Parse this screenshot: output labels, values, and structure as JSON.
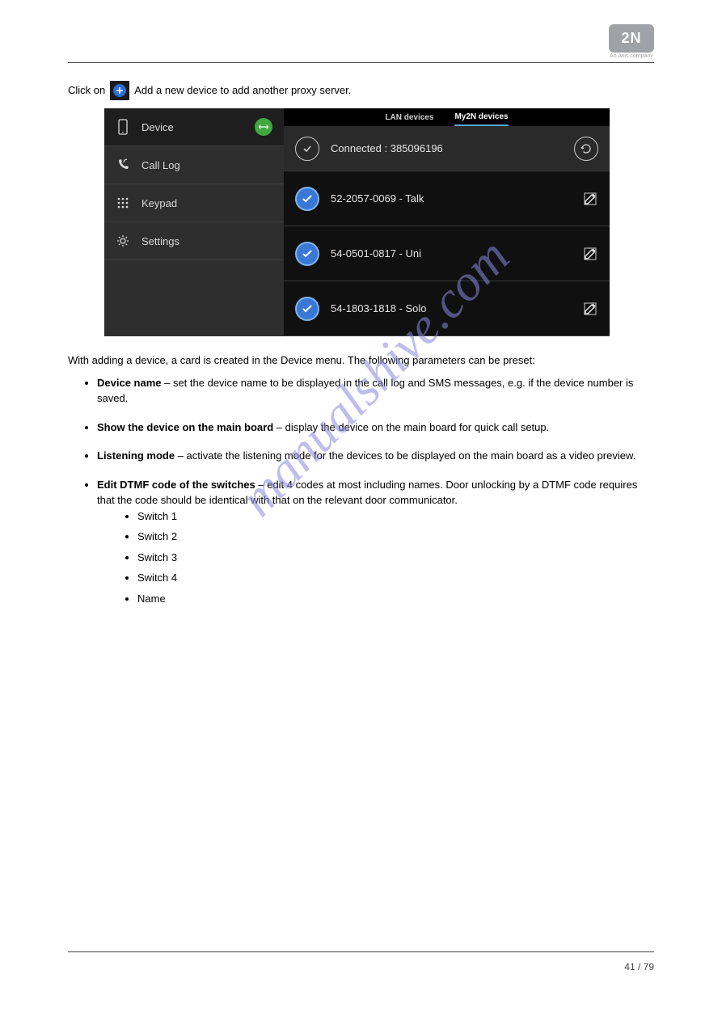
{
  "logo": {
    "text": "2N",
    "subtitle": "An Axis company"
  },
  "intro": {
    "pre": "Click on",
    "post": "Add a new device to add another proxy server."
  },
  "screenshot": {
    "sidebar": {
      "items": [
        {
          "label": "Device",
          "icon": "phone-icon",
          "active": true,
          "badge": true
        },
        {
          "label": "Call Log",
          "icon": "call-log-icon",
          "active": false,
          "badge": false
        },
        {
          "label": "Keypad",
          "icon": "keypad-icon",
          "active": false,
          "badge": false
        },
        {
          "label": "Settings",
          "icon": "gear-icon",
          "active": false,
          "badge": false
        }
      ]
    },
    "tabs": {
      "left": "LAN devices",
      "right": "My2N devices"
    },
    "connected": {
      "label": "Connected : 385096196"
    },
    "devices": [
      {
        "label": "52-2057-0069 - Talk"
      },
      {
        "label": "54-0501-0817 - Uni"
      },
      {
        "label": "54-1803-1818 - Solo"
      }
    ]
  },
  "watermark": "manualshive.com",
  "paragraphs": {
    "lead": "With adding a device, a card is created in the Device menu. The following parameters can be preset:"
  },
  "bullets": [
    {
      "strong": "Device name",
      "text": " – set the device name to be displayed in the call log and SMS messages, e.g. if the device number is saved."
    },
    {
      "strong": "Show the device on the main board",
      "text": " – display the device on the main board for quick call setup."
    },
    {
      "strong": "Listening mode",
      "text": " – activate the listening mode for the devices to be displayed on the main board as a video preview."
    },
    {
      "strong": "Edit DTMF code of the switches",
      "text": " – edit 4 codes at most including names. Door unlocking by a DTMF code requires that the code should be identical with that on the relevant door communicator.",
      "sub": [
        "Switch 1",
        "Switch 2",
        "Switch 3",
        "Switch 4",
        "Name"
      ]
    }
  ],
  "footer": "41 / 79"
}
